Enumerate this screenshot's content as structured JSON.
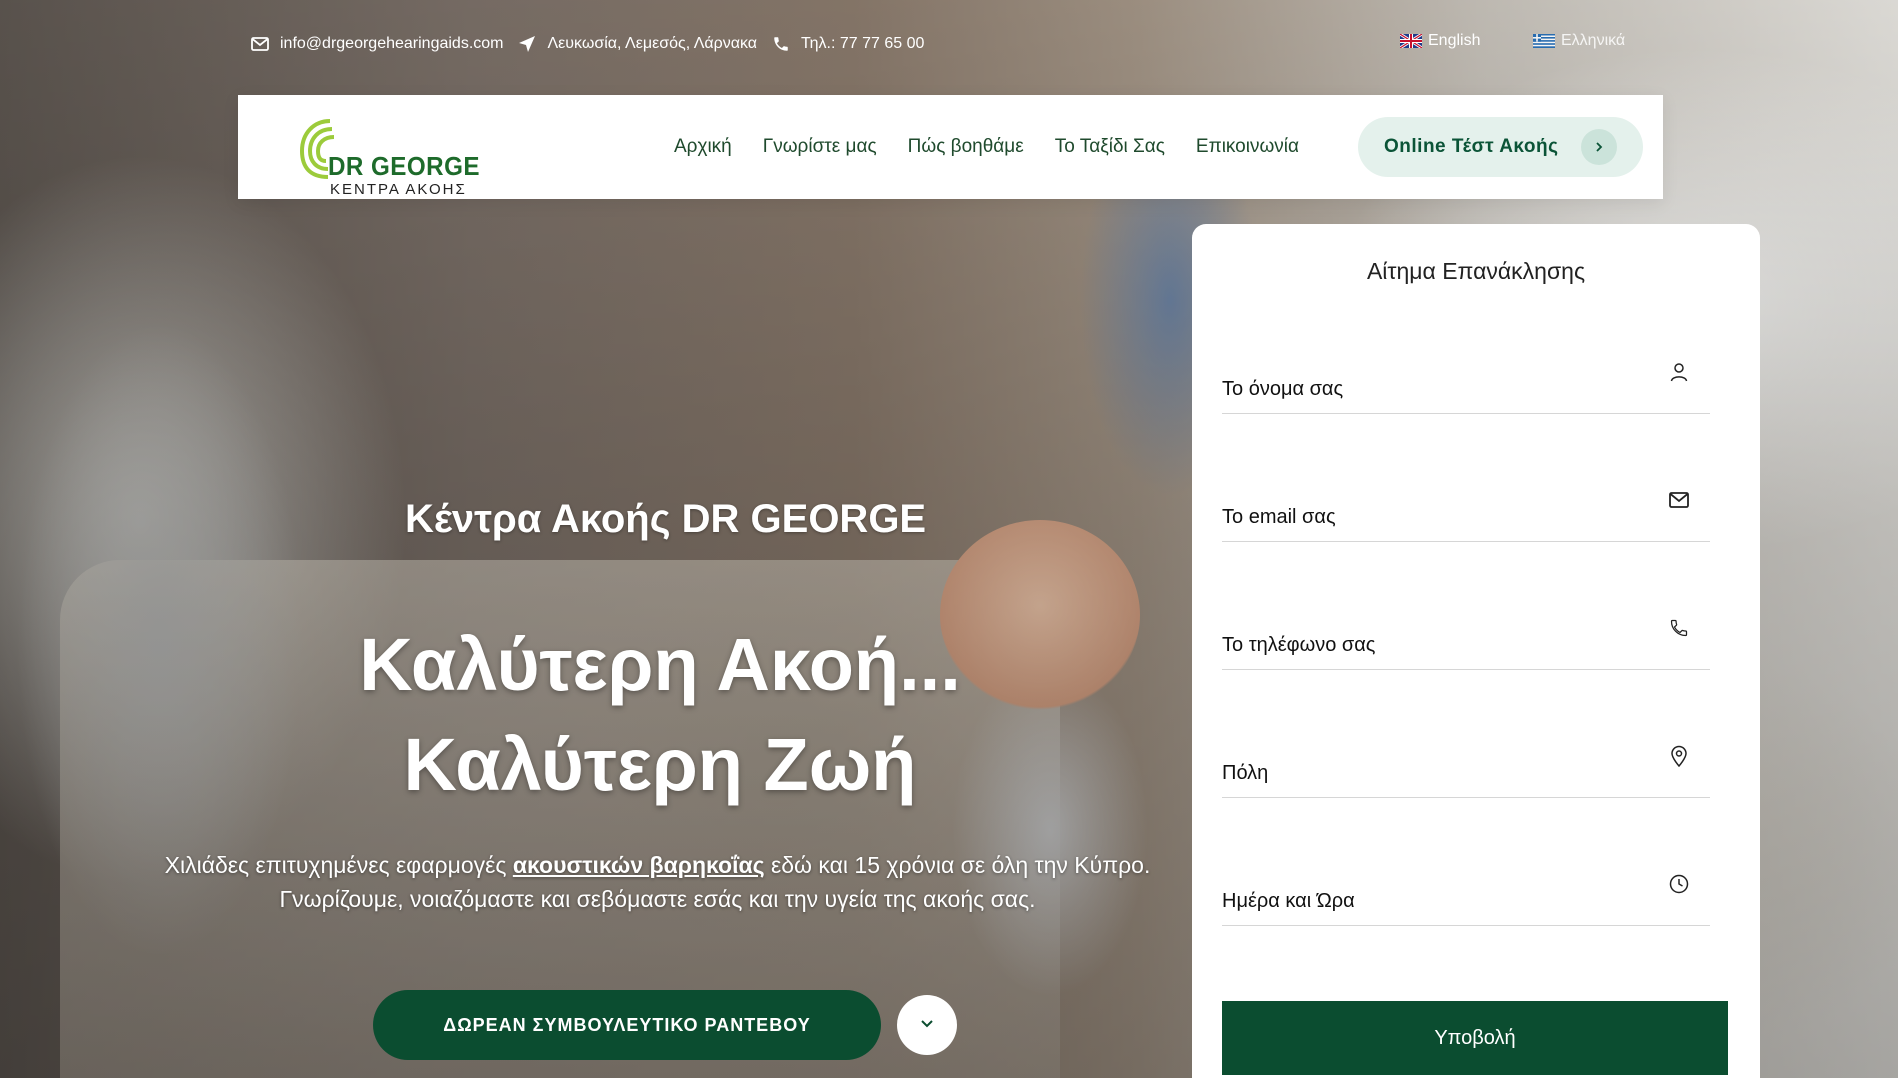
{
  "topbar": {
    "email": "info@drgeorgehearingaids.com",
    "location": "Λευκωσία, Λεμεσός, Λάρνακα",
    "phone": "Τηλ.: 77 77 65 00",
    "lang_english": "English",
    "lang_greek": "Ελληνικά",
    "icons": [
      "envelope-icon",
      "location-arrow-icon",
      "phone-icon"
    ]
  },
  "brand": {
    "logo_line1": "DR GEORGE",
    "logo_line2": "ΚΕΝΤΡΑ ΑΚΟΗΣ",
    "green": "#1e6b2b",
    "dark_green": "#0b4d30"
  },
  "nav": {
    "items": [
      {
        "label": "Αρχική"
      },
      {
        "label": "Γνωρίστε μας"
      },
      {
        "label": "Πώς βοηθάμε"
      },
      {
        "label": "Το Ταξίδι Σας"
      },
      {
        "label": "Επικοινωνία"
      }
    ],
    "cta_label": "Online Τέστ Ακοής"
  },
  "hero": {
    "subtitle": "Κέντρα Ακοής DR GEORGE",
    "title_line1": "Καλύτερη Ακοή...",
    "title_line2": "Καλύτερη Ζωή",
    "desc_before": "Χιλιάδες επιτυχημένες εφαρμογές ",
    "desc_link": "ακουστικών βαρηκοΐας",
    "desc_after": " εδώ και 15 χρόνια σε όλη την Κύπρο. Γνωρίζουμε, νοιαζόμαστε και σεβόμαστε εσάς και την υγεία της ακοής σας.",
    "button_label": "ΔΩΡΕΑΝ ΣΥΜΒΟΥΛΕΥΤΙΚΟ ΡΑΝΤΕΒΟΥ"
  },
  "form": {
    "title": "Αίτημα Επανάκλησης",
    "fields": [
      {
        "label": "Το όνομα σας",
        "icon": "user-icon"
      },
      {
        "label": "Το email σας",
        "icon": "envelope-icon"
      },
      {
        "label": "Το τηλέφωνο σας",
        "icon": "phone-icon"
      },
      {
        "label": "Πόλη",
        "icon": "map-pin-icon"
      },
      {
        "label": "Ημέρα και Ώρα",
        "icon": "clock-icon"
      }
    ],
    "submit_label": "Υποβολή"
  }
}
